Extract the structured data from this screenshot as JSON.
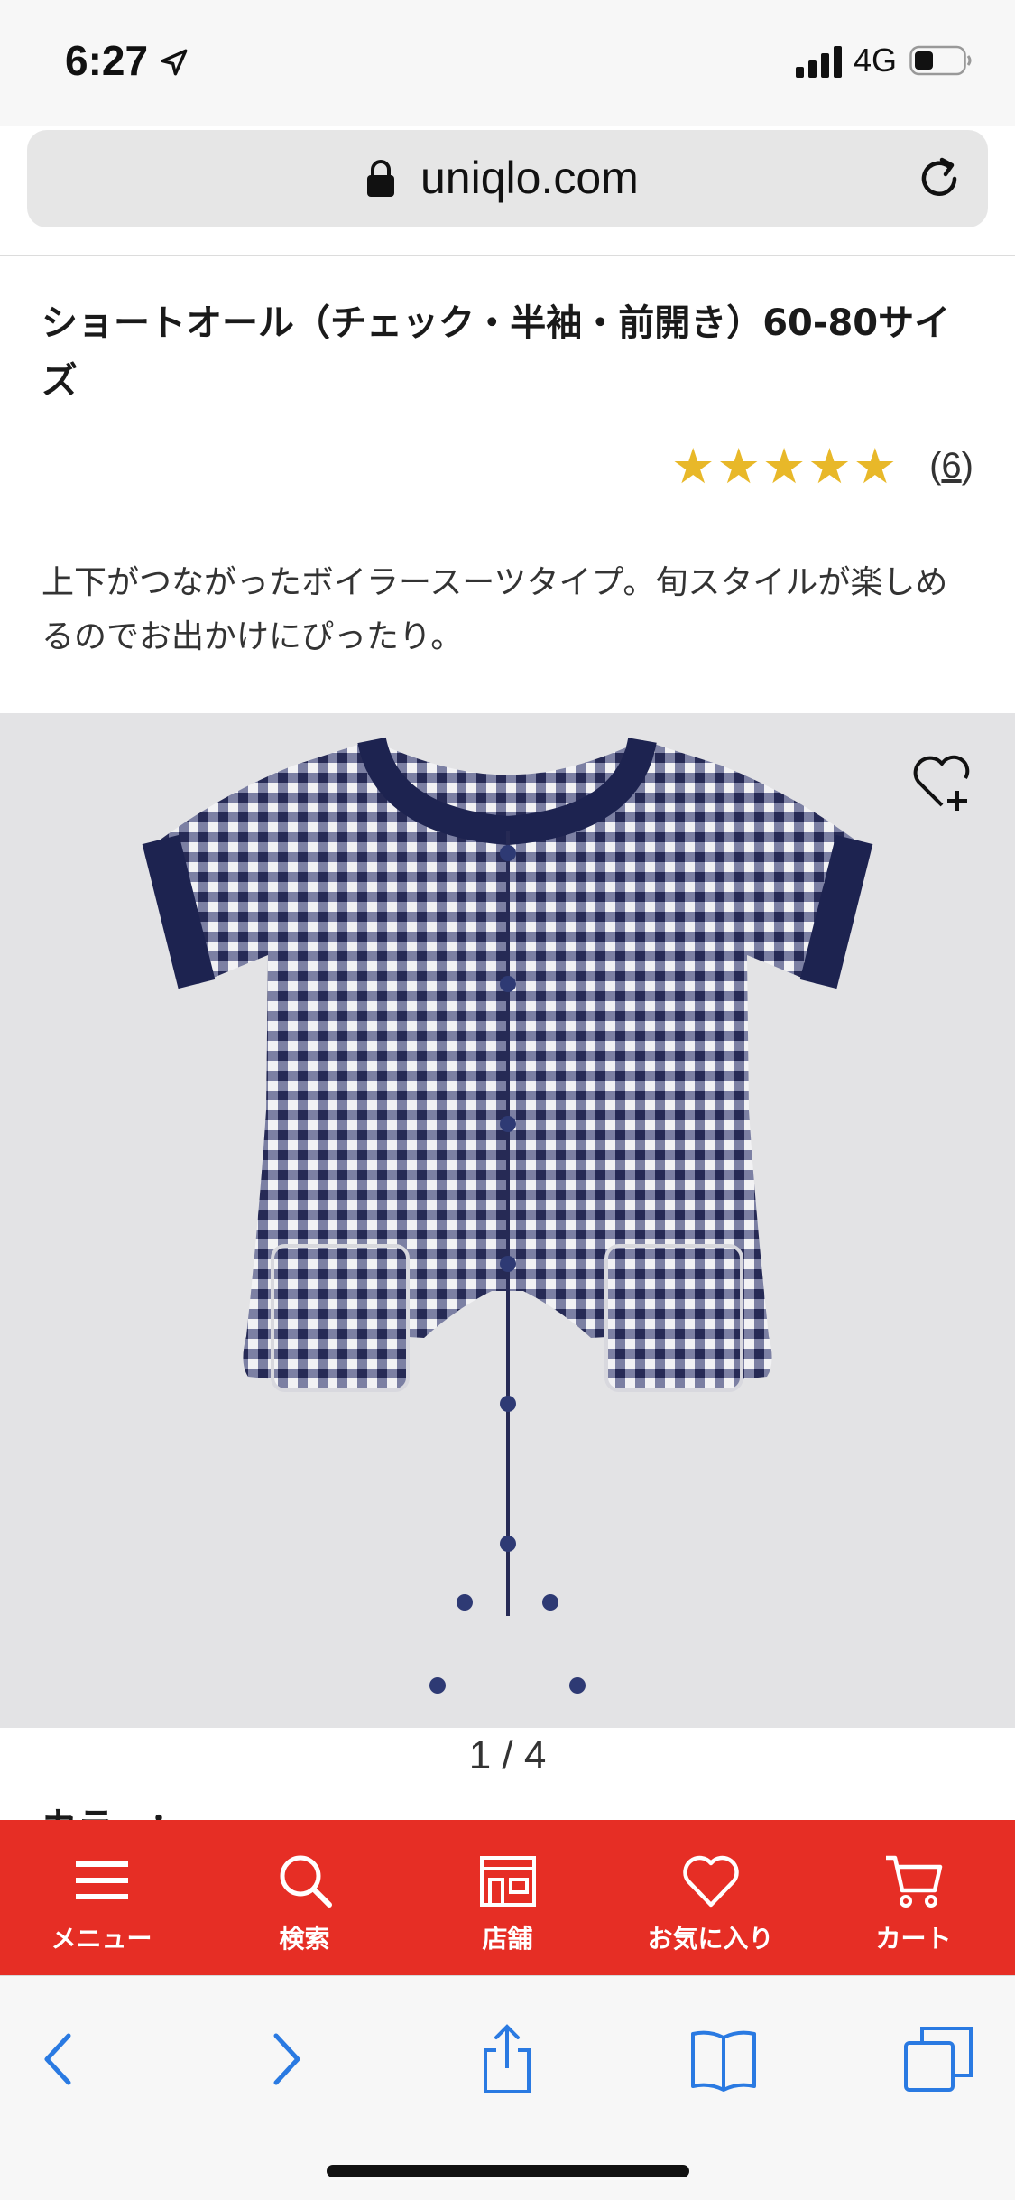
{
  "status_bar": {
    "time": "6:27",
    "network": "4G"
  },
  "browser": {
    "url": "uniqlo.com"
  },
  "product": {
    "title": "ショートオール（チェック・半袖・前開き）60-80サイズ",
    "rating_stars": 5,
    "review_count": "6",
    "description": "上下がつながったボイラースーツタイプ。旬スタイルが楽しめるのでお出かけにぴったり。",
    "image_pager": "1 / 4",
    "color_label": "カラー："
  },
  "nav": {
    "items": [
      {
        "label": "メニュー",
        "icon": "menu-icon"
      },
      {
        "label": "検索",
        "icon": "search-icon"
      },
      {
        "label": "店舗",
        "icon": "store-icon"
      },
      {
        "label": "お気に入り",
        "icon": "heart-icon"
      },
      {
        "label": "カート",
        "icon": "cart-icon"
      }
    ]
  },
  "colors": {
    "brand_red": "#e62e25",
    "star": "#e8b829",
    "link_blue": "#2a7ae2",
    "navy": "#1d2350"
  }
}
